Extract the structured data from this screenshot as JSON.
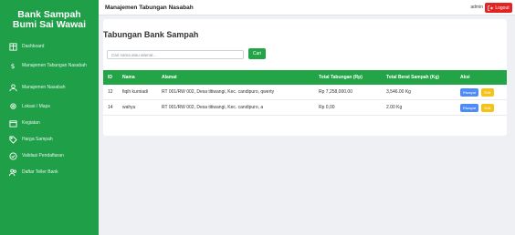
{
  "sidebar": {
    "brand_line1": "Bank Sampah",
    "brand_line2": "Bumi Sai Wawai",
    "items": [
      {
        "label": "Dashboard",
        "icon": "grid-icon"
      },
      {
        "label": "Manajemen Tabungan Nasabah",
        "icon": "dollar-icon"
      },
      {
        "label": "Manajemen Nasabah",
        "icon": "user-icon"
      },
      {
        "label": "Lokasi / Maps",
        "icon": "map-pin-icon"
      },
      {
        "label": "Kegiatan",
        "icon": "calendar-icon"
      },
      {
        "label": "Harga Sampah",
        "icon": "tags-icon"
      },
      {
        "label": "Validasi Pendaftaran",
        "icon": "check-circle-icon"
      },
      {
        "label": "Daftar Teller Bank",
        "icon": "users-icon"
      }
    ]
  },
  "topbar": {
    "title": "Manajemen Tabungan Nasabah",
    "user": "admin",
    "logout_label": "Logout"
  },
  "main": {
    "page_title": "Tabungan Bank Sampah",
    "search_placeholder": "Cari nama atau alamat...",
    "search_button": "Cari"
  },
  "table": {
    "headers": [
      "ID",
      "Nama",
      "Alamat",
      "Total Tabungan (Rp)",
      "Total Berat Sampah (Kg)",
      "Aksi"
    ],
    "rows": [
      {
        "id": "12",
        "nama": "fiqih kurniadi",
        "alamat": "RT 001/RW 002, Desa titiwangi, Kec. candipuro, qwerty",
        "tabungan": "Rp 7,258,000.00",
        "berat": "3,546.00 Kg",
        "btn1": "Riwayat",
        "btn2": "Edit"
      },
      {
        "id": "14",
        "nama": "wahyu",
        "alamat": "RT 001/RW 002, Desa titiwangi, Kec. candipuro, a",
        "tabungan": "Rp 0,00",
        "berat": "2.00 Kg",
        "btn1": "Riwayat",
        "btn2": "Edit"
      }
    ]
  },
  "colors": {
    "sidebar": "#1f9f48",
    "accent": "#22a447",
    "logout": "#e02424",
    "riwayat": "#4e8cf5",
    "edit": "#f5c21a"
  }
}
